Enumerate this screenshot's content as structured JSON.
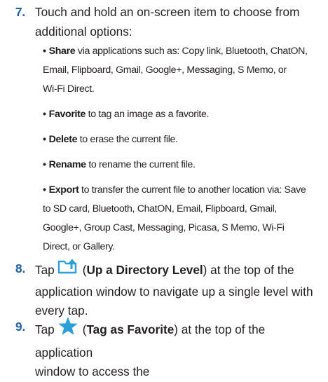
{
  "step7": {
    "number": "7.",
    "text_line1": "Touch and hold an on-screen item to choose from",
    "text_line2": "additional options:"
  },
  "bullets": [
    {
      "term": "Share",
      "lines": [
        " via applications such as: Copy link, Bluetooth, ChatON,",
        "Email, Flipboard, Gmail, Google+, Messaging, S Memo, or",
        "Wi-Fi Direct."
      ]
    },
    {
      "term": "Favorite",
      "lines": [
        " to tag an image as a favorite."
      ]
    },
    {
      "term": "Delete",
      "lines": [
        " to erase the current file."
      ]
    },
    {
      "term": "Rename",
      "lines": [
        " to rename the current file."
      ]
    },
    {
      "term": "Export",
      "lines": [
        " to transfer the current file to another location via: Save",
        "to SD card, Bluetooth, ChatON, Email, Flipboard, Gmail,",
        "Google+, Group Cast, Messaging, Picasa, S Memo, Wi-Fi",
        "Direct, or Gallery."
      ]
    }
  ],
  "step8": {
    "number": "8.",
    "tap": "Tap",
    "icon": "folder-up-arrow-icon",
    "open_paren": "(",
    "label": "Up a Directory Level",
    "close_rest": ") at the top of the",
    "line2": "application window to navigate up a single level with",
    "line3": "every tap."
  },
  "step9": {
    "number": "9.",
    "tap": "Tap",
    "icon": "star-icon",
    "open_paren": "(",
    "label": "Tag as Favorite",
    "close_rest": ") at the top of the application",
    "line2": "window to access the"
  },
  "colors": {
    "step_number": "#1a5ea8",
    "icon_blue": "#2a9fd8",
    "text": "#231f20"
  }
}
